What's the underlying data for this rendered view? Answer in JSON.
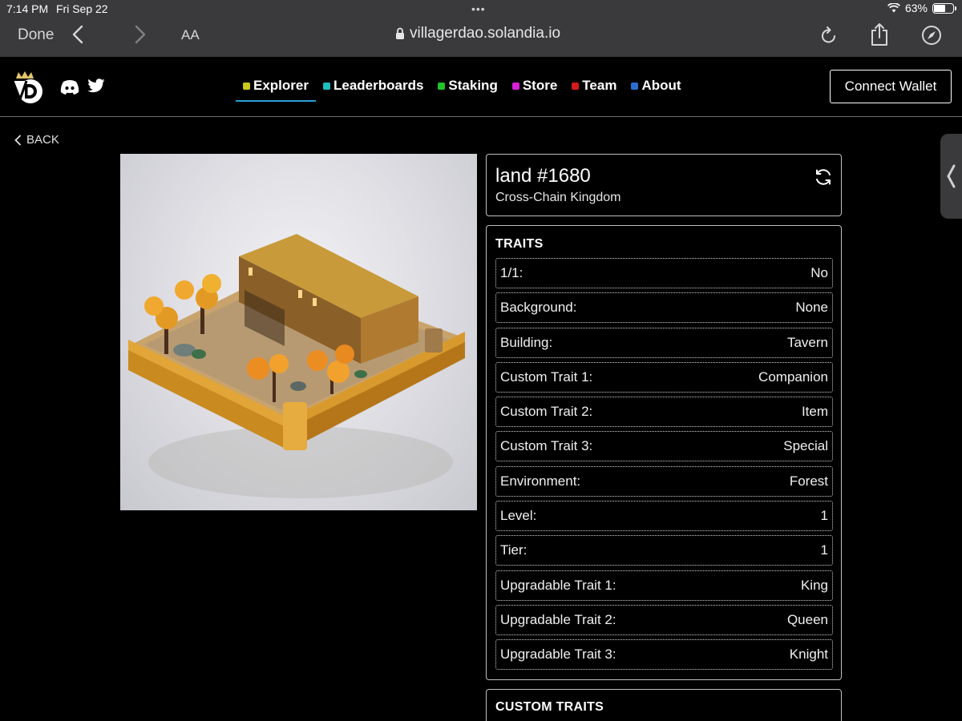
{
  "status_bar": {
    "time": "7:14 PM",
    "date": "Fri Sep 22",
    "battery": "63%",
    "battery_level": 0.63
  },
  "browser": {
    "done_label": "Done",
    "text_size_label": "AA",
    "url": "villagerdao.solandia.io"
  },
  "site": {
    "nav": [
      {
        "label": "Explorer",
        "color": "#c8c81e",
        "active": true
      },
      {
        "label": "Leaderboards",
        "color": "#1fbfbf"
      },
      {
        "label": "Staking",
        "color": "#22c22a"
      },
      {
        "label": "Store",
        "color": "#d81fd8"
      },
      {
        "label": "Team",
        "color": "#d41a1a"
      },
      {
        "label": "About",
        "color": "#2a6fd0"
      }
    ],
    "connect_wallet_label": "Connect Wallet",
    "back_label": "BACK"
  },
  "nft": {
    "title": "land #1680",
    "collection": "Cross-Chain Kingdom",
    "traits_heading": "TRAITS",
    "traits": [
      {
        "name": "1/1:",
        "value": "No"
      },
      {
        "name": "Background:",
        "value": "None"
      },
      {
        "name": "Building:",
        "value": "Tavern"
      },
      {
        "name": "Custom Trait 1:",
        "value": "Companion"
      },
      {
        "name": "Custom Trait 2:",
        "value": "Item"
      },
      {
        "name": "Custom Trait 3:",
        "value": "Special"
      },
      {
        "name": "Environment:",
        "value": "Forest"
      },
      {
        "name": "Level:",
        "value": "1"
      },
      {
        "name": "Tier:",
        "value": "1"
      },
      {
        "name": "Upgradable Trait 1:",
        "value": "King"
      },
      {
        "name": "Upgradable Trait 2:",
        "value": "Queen"
      },
      {
        "name": "Upgradable Trait 3:",
        "value": "Knight"
      }
    ],
    "custom_traits_heading": "CUSTOM TRAITS"
  },
  "icons": [
    "wifi-icon",
    "battery-icon",
    "chevron-left-icon",
    "chevron-right-icon",
    "lock-icon",
    "reload-icon",
    "share-icon",
    "compass-icon",
    "discord-icon",
    "twitter-icon",
    "refresh-icon"
  ]
}
